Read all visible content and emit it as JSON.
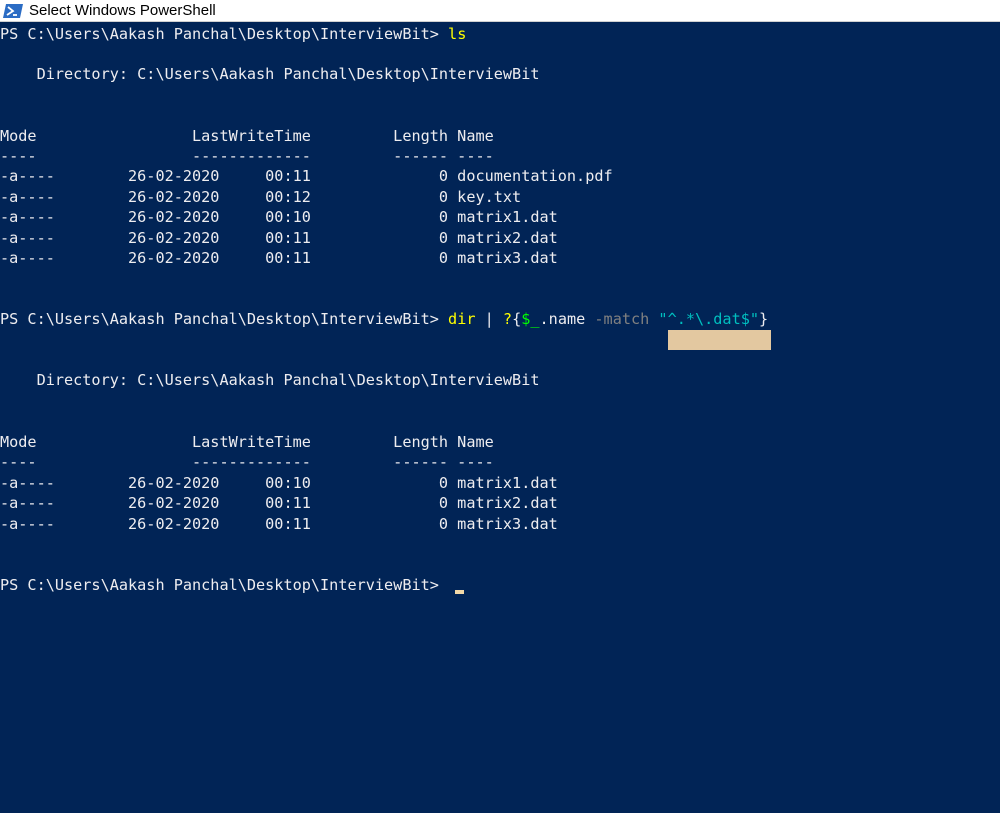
{
  "window": {
    "title": "Select Windows PowerShell",
    "icon": "powershell-icon"
  },
  "console": {
    "prompt1": "PS C:\\Users\\Aakash Panchal\\Desktop\\InterviewBit> ",
    "command1": "ls",
    "dir_header1": "    Directory: C:\\Users\\Aakash Panchal\\Desktop\\InterviewBit",
    "columns_line1": "Mode                 LastWriteTime         Length Name",
    "underline1": "----                 -------------         ------ ----",
    "listing1": [
      "-a----        26-02-2020     00:11              0 documentation.pdf",
      "-a----        26-02-2020     00:12              0 key.txt",
      "-a----        26-02-2020     00:10              0 matrix1.dat",
      "-a----        26-02-2020     00:11              0 matrix2.dat",
      "-a----        26-02-2020     00:11              0 matrix3.dat"
    ],
    "prompt2": "PS C:\\Users\\Aakash Panchal\\Desktop\\InterviewBit> ",
    "command2": {
      "cmd": "dir",
      "pipe": " | ",
      "where": "?",
      "open_brace": "{",
      "variable": "$_",
      "property": ".name ",
      "param": "-match ",
      "string": "\"^.*\\.dat$\"",
      "close_brace": "}"
    },
    "dir_header2": "    Directory: C:\\Users\\Aakash Panchal\\Desktop\\InterviewBit",
    "columns_line2": "Mode                 LastWriteTime         Length Name",
    "underline2": "----                 -------------         ------ ----",
    "listing2": [
      "-a----        26-02-2020     00:10              0 matrix1.dat",
      "-a----        26-02-2020     00:11              0 matrix2.dat",
      "-a----        26-02-2020     00:11              0 matrix3.dat"
    ],
    "prompt3": "PS C:\\Users\\Aakash Panchal\\Desktop\\InterviewBit> "
  },
  "colors": {
    "background": "#012456",
    "foreground": "#eeedf0",
    "command": "#ffff00",
    "variable": "#00ff00",
    "parameter": "#808080",
    "string": "#00bfbf",
    "selection": "#e3c8a0"
  }
}
